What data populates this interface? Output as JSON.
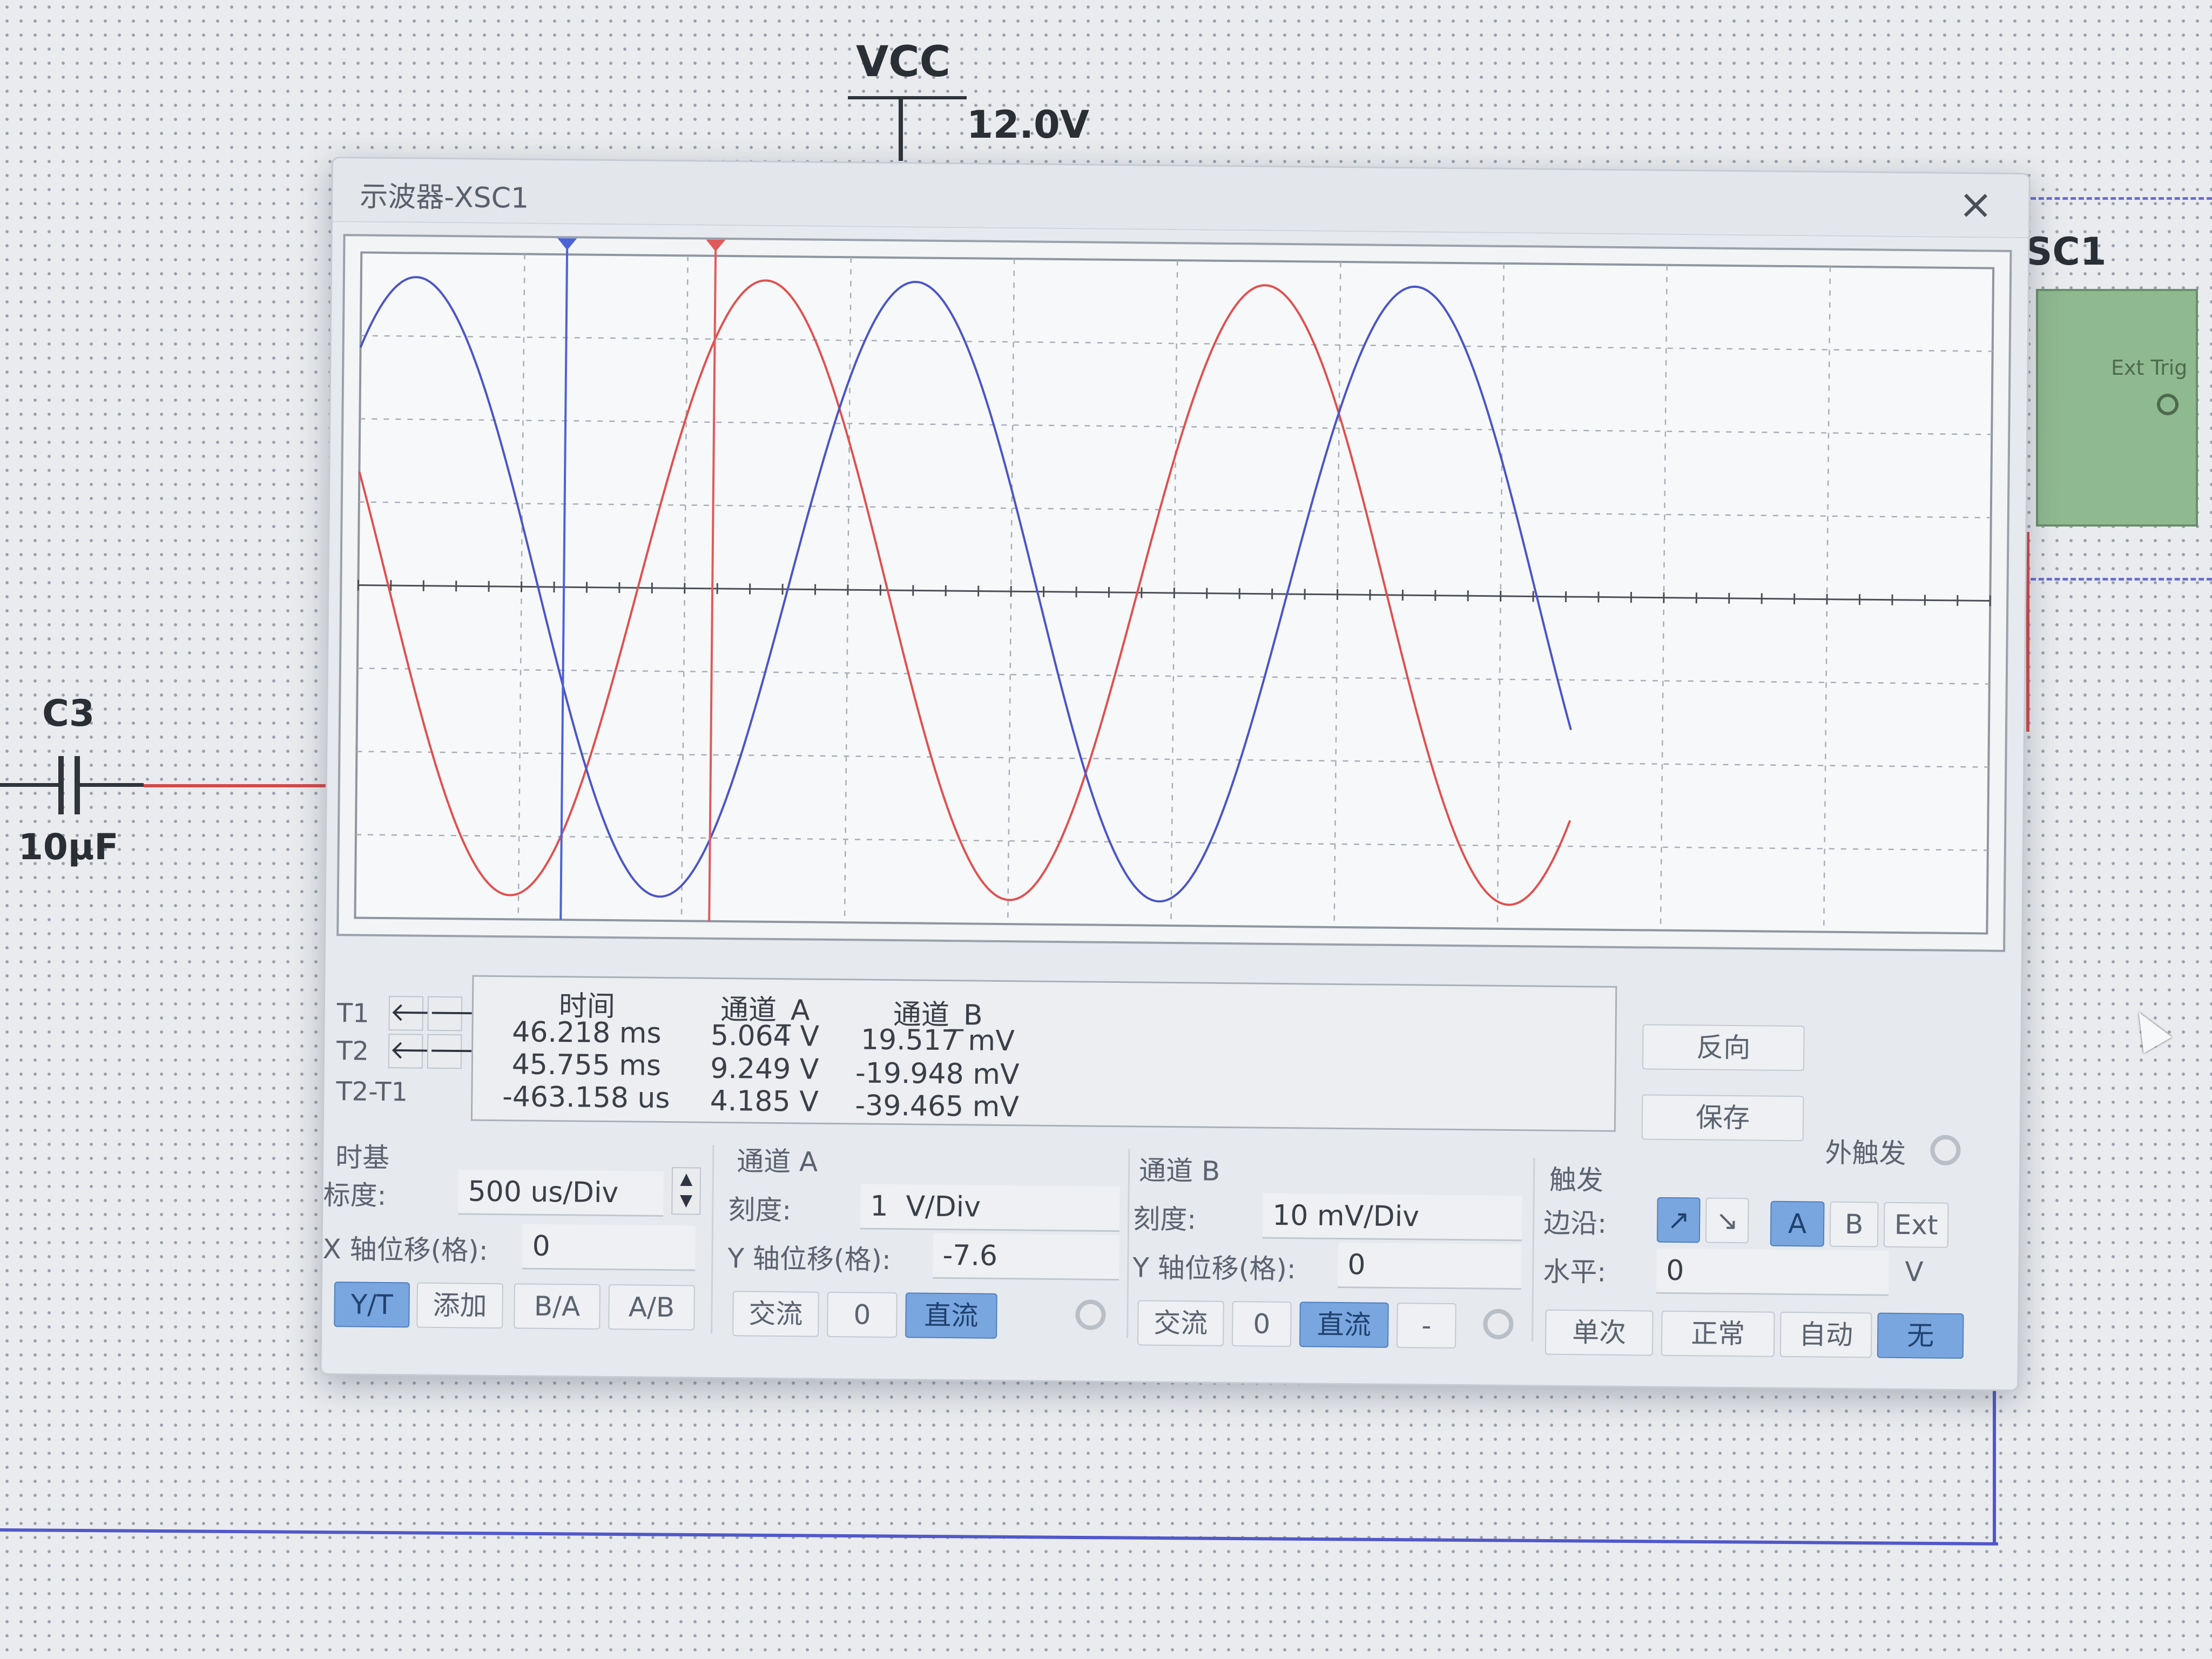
{
  "schematic": {
    "vcc_label": "VCC",
    "vcc_voltage": "12.0V",
    "capacitor_name": "C3",
    "capacitor_value": "10μF",
    "instrument_label": "SC1",
    "ext_trig_label": "Ext Trig"
  },
  "window": {
    "title": "示波器-XSC1",
    "close": "×"
  },
  "readout": {
    "headers": {
      "time": "时间",
      "channel_a": "通道_A",
      "channel_b": "通道_B"
    },
    "rows": [
      {
        "label": "T1",
        "time": "46.218 ms",
        "a": "5.064 V",
        "b": "19.517 mV"
      },
      {
        "label": "T2",
        "time": "45.755 ms",
        "a": "9.249 V",
        "b": "-19.948 mV"
      },
      {
        "label": "T2-T1",
        "time": "-463.158 us",
        "a": "4.185 V",
        "b": "-39.465 mV"
      }
    ],
    "arrow_left": "🡐",
    "arrow_right": "🡒"
  },
  "buttons": {
    "reverse": "反向",
    "save": "保存",
    "ext_trigger": "外触发"
  },
  "timebase": {
    "title": "时基",
    "scale_label": "标度:",
    "scale_value": "500 us/Div",
    "xpos_label": "X 轴位移(格):",
    "xpos_value": "0",
    "modes": [
      "Y/T",
      "添加",
      "B/A",
      "A/B"
    ]
  },
  "channel_a": {
    "title": "通道 A",
    "scale_label": "刻度:",
    "scale_value": "1  V/Div",
    "ypos_label": "Y 轴位移(格):",
    "ypos_value": "-7.6",
    "coupling": [
      "交流",
      "0",
      "直流"
    ]
  },
  "channel_b": {
    "title": "通道 B",
    "scale_label": "刻度:",
    "scale_value": "10 mV/Div",
    "ypos_label": "Y 轴位移(格):",
    "ypos_value": "0",
    "coupling": [
      "交流",
      "0",
      "直流",
      "-"
    ]
  },
  "trigger": {
    "title": "触发",
    "edge_label": "边沿:",
    "edge_rising": "↗",
    "edge_falling": "↘",
    "sources": [
      "A",
      "B",
      "Ext"
    ],
    "level_label": "水平:",
    "level_value": "0",
    "level_unit": "V",
    "modes": [
      "单次",
      "正常",
      "自动",
      "无"
    ]
  },
  "colors": {
    "channel_a_trace": "#e05050",
    "channel_b_trace": "#4a55c8",
    "cursor_t1": "#4b63d8",
    "cursor_t2": "#e05a5a",
    "active_button": "#7aa6df"
  }
}
